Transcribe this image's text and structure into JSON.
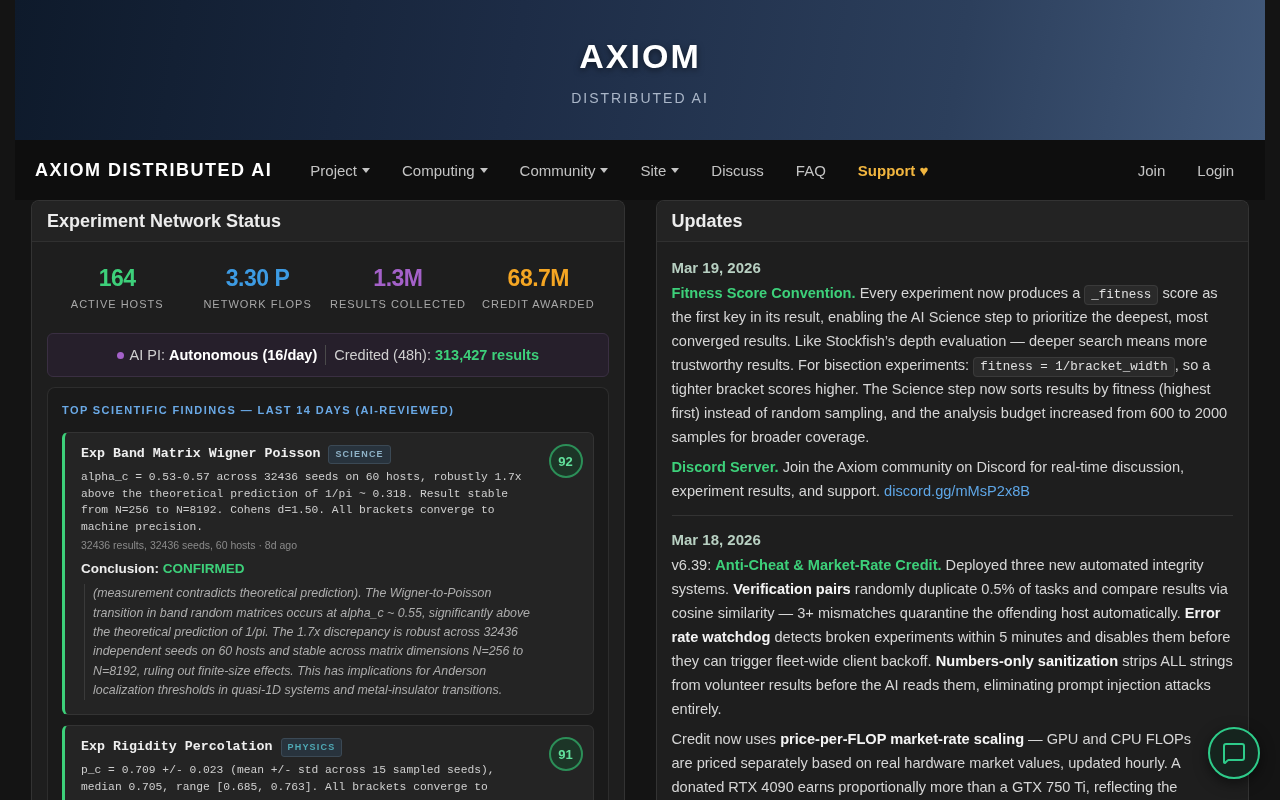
{
  "hero": {
    "title": "AXIOM",
    "subtitle": "DISTRIBUTED AI"
  },
  "navbar": {
    "brand": "AXIOM DISTRIBUTED AI",
    "items": [
      {
        "label": "Project",
        "kind": "menu",
        "dropdown": true
      },
      {
        "label": "Computing",
        "kind": "menu",
        "dropdown": true
      },
      {
        "label": "Community",
        "kind": "menu",
        "dropdown": true
      },
      {
        "label": "Site",
        "kind": "menu",
        "dropdown": true
      },
      {
        "label": "Discuss",
        "kind": "menu",
        "dropdown": false
      },
      {
        "label": "FAQ",
        "kind": "menu",
        "dropdown": false
      },
      {
        "label": "Support ♥",
        "kind": "highlight",
        "dropdown": false
      }
    ],
    "account_links": [
      {
        "label": "Join"
      },
      {
        "label": "Login"
      }
    ]
  },
  "network_status": {
    "title": "Experiment Network Status",
    "stats": [
      {
        "value": "164",
        "label": "ACTIVE HOSTS",
        "color": "#3dd07a"
      },
      {
        "value": "3.30 P",
        "label": "NETWORK FLOPS",
        "color": "#3d9be3"
      },
      {
        "value": "1.3M",
        "label": "RESULTS COLLECTED",
        "color": "#a461c9"
      },
      {
        "value": "68.7M",
        "label": "CREDIT AWARDED",
        "color": "#f5a623"
      }
    ],
    "ai_pi": {
      "label": "AI PI:",
      "mode": "Autonomous (16/day)",
      "credited_label": "Credited (48h):",
      "credited_value": "313,427 results"
    },
    "findings": {
      "title": "TOP SCIENTIFIC FINDINGS — LAST 14 DAYS (AI-REVIEWED)",
      "items": [
        {
          "title": "Exp Band Matrix Wigner Poisson",
          "tag": {
            "label": "SCIENCE",
            "color": "#8fb3c8"
          },
          "score": "92",
          "description": "alpha_c = 0.53-0.57 across 32436 seeds on 60 hosts, robustly 1.7x above the theoretical prediction of 1/pi ~ 0.318. Result stable from N=256 to N=8192. Cohens d=1.50. All brackets converge to machine precision.",
          "meta": "32436 results, 32436 seeds, 60 hosts · 8d ago",
          "conclusion_label": "Conclusion:",
          "verdict": "CONFIRMED",
          "summary": "(measurement contradicts theoretical prediction). The Wigner-to-Poisson transition in band random matrices occurs at alpha_c ~ 0.55, significantly above the theoretical prediction of 1/pi. The 1.7x discrepancy is robust across 32436 independent seeds on 60 hosts and stable across matrix dimensions N=256 to N=8192, ruling out finite-size effects. This has implications for Anderson localization thresholds in quasi-1D systems and metal-insulator transitions."
        },
        {
          "title": "Exp Rigidity Percolation",
          "tag": {
            "label": "PHYSICS",
            "color": "#4fa9b5"
          },
          "score": "91",
          "description": "p_c = 0.709 +/- 0.023 (mean +/- std across 15 sampled seeds), median 0.705, range [0.685, 0.763]. All brackets converge to"
        }
      ]
    }
  },
  "updates": {
    "title": "Updates",
    "entries": [
      {
        "date": "Mar 19, 2026",
        "paragraphs": [
          [
            {
              "kind": "title",
              "text": "Fitness Score Convention."
            },
            {
              "kind": "text",
              "text": " Every experiment now produces a "
            },
            {
              "kind": "code",
              "text": "_fitness"
            },
            {
              "kind": "text",
              "text": " score as the first key in its result, enabling the AI Science step to prioritize the deepest, most converged results. Like Stockfish’s depth evaluation — deeper search means more trustworthy results. For bisection experiments: "
            },
            {
              "kind": "code",
              "text": "fitness = 1/bracket_width"
            },
            {
              "kind": "text",
              "text": ", so a tighter bracket scores higher. The Science step now sorts results by fitness (highest first) instead of random sampling, and the analysis budget increased from 600 to 2000 samples for broader coverage."
            }
          ],
          [
            {
              "kind": "title",
              "text": "Discord Server."
            },
            {
              "kind": "text",
              "text": " Join the Axiom community on Discord for real-time discussion, experiment results, and support. "
            },
            {
              "kind": "link",
              "text": "discord.gg/mMsP2x8B"
            }
          ]
        ]
      },
      {
        "date": "Mar 18, 2026",
        "paragraphs": [
          [
            {
              "kind": "text",
              "text": "v6.39: "
            },
            {
              "kind": "title",
              "text": "Anti-Cheat & Market-Rate Credit."
            },
            {
              "kind": "text",
              "text": " Deployed three new automated integrity systems. **Verification pairs** randomly duplicate 0.5% of tasks and compare results via cosine similarity — 3+ mismatches quarantine the offending host automatically. **Error rate watchdog** detects broken experiments within 5 minutes and disables them before they can trigger fleet-wide client backoff. **Numbers-only sanitization** strips ALL strings from volunteer results before the AI reads them, eliminating prompt injection attacks entirely."
            }
          ],
          [
            {
              "kind": "text",
              "text": "Credit now uses **price-per-FLOP market-rate scaling** — GPU and CPU FLOPs are priced separately based on real hardware market values, updated hourly. A donated RTX 4090 earns proportionally more than a GTX 750 Ti, reflecting the"
            }
          ]
        ]
      }
    ]
  }
}
